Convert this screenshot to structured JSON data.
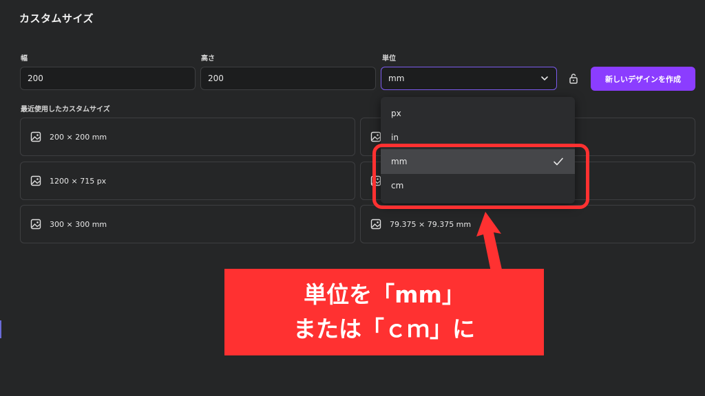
{
  "page": {
    "title": "カスタムサイズ"
  },
  "form": {
    "width_label": "幅",
    "width_value": "200",
    "height_label": "高さ",
    "height_value": "200",
    "unit_label": "単位",
    "unit_value": "mm",
    "create_button": "新しいデザインを作成"
  },
  "recent": {
    "label": "最近使用したカスタムサイズ",
    "items": [
      "200 × 200 mm",
      "1200 × 715 px",
      "300 × 300 mm",
      "",
      "",
      "79.375 × 79.375 mm"
    ]
  },
  "unit_dropdown": {
    "options": [
      "px",
      "in",
      "mm",
      "cm"
    ],
    "selected": "mm"
  },
  "annotation": {
    "line1": "単位を「mm」",
    "line2": "または「ｃｍ」に",
    "color": "#ff3131"
  },
  "colors": {
    "accent": "#8b3dff",
    "select_border": "#7d5cf0",
    "background": "#252627"
  }
}
